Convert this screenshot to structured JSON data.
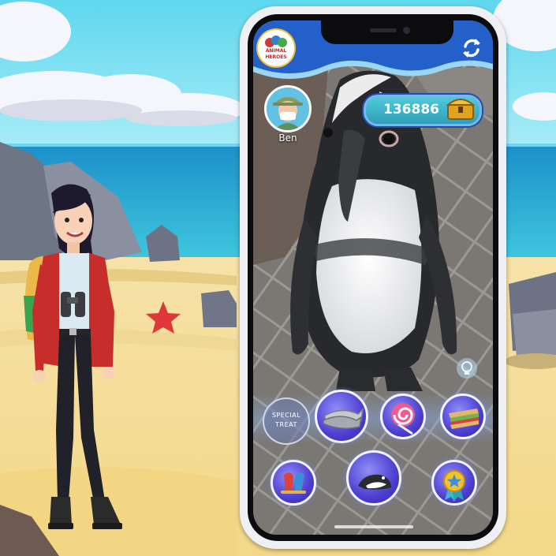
{
  "app": {
    "logo_text_top": "ANIMAL",
    "logo_text_bottom": "HEROES",
    "refresh_icon": "refresh-icon"
  },
  "player": {
    "name": "Ben",
    "coins": "136886",
    "treasure_icon": "treasure-chest-icon"
  },
  "feed_tray": {
    "special_treat_line1": "SPECIAL",
    "special_treat_line2": "TREAT",
    "items": [
      "sardines-icon",
      "lollipop-icon",
      "sandwich-icon"
    ]
  },
  "bottom_actions": [
    "birds-icon",
    "penguin-icon",
    "award-badge-icon"
  ],
  "hint_icon": "lightbulb-icon",
  "colors": {
    "header_blue": "#2360c9",
    "button_purple": "#4d3fd1",
    "coin_pill": "#3fb6c9"
  }
}
